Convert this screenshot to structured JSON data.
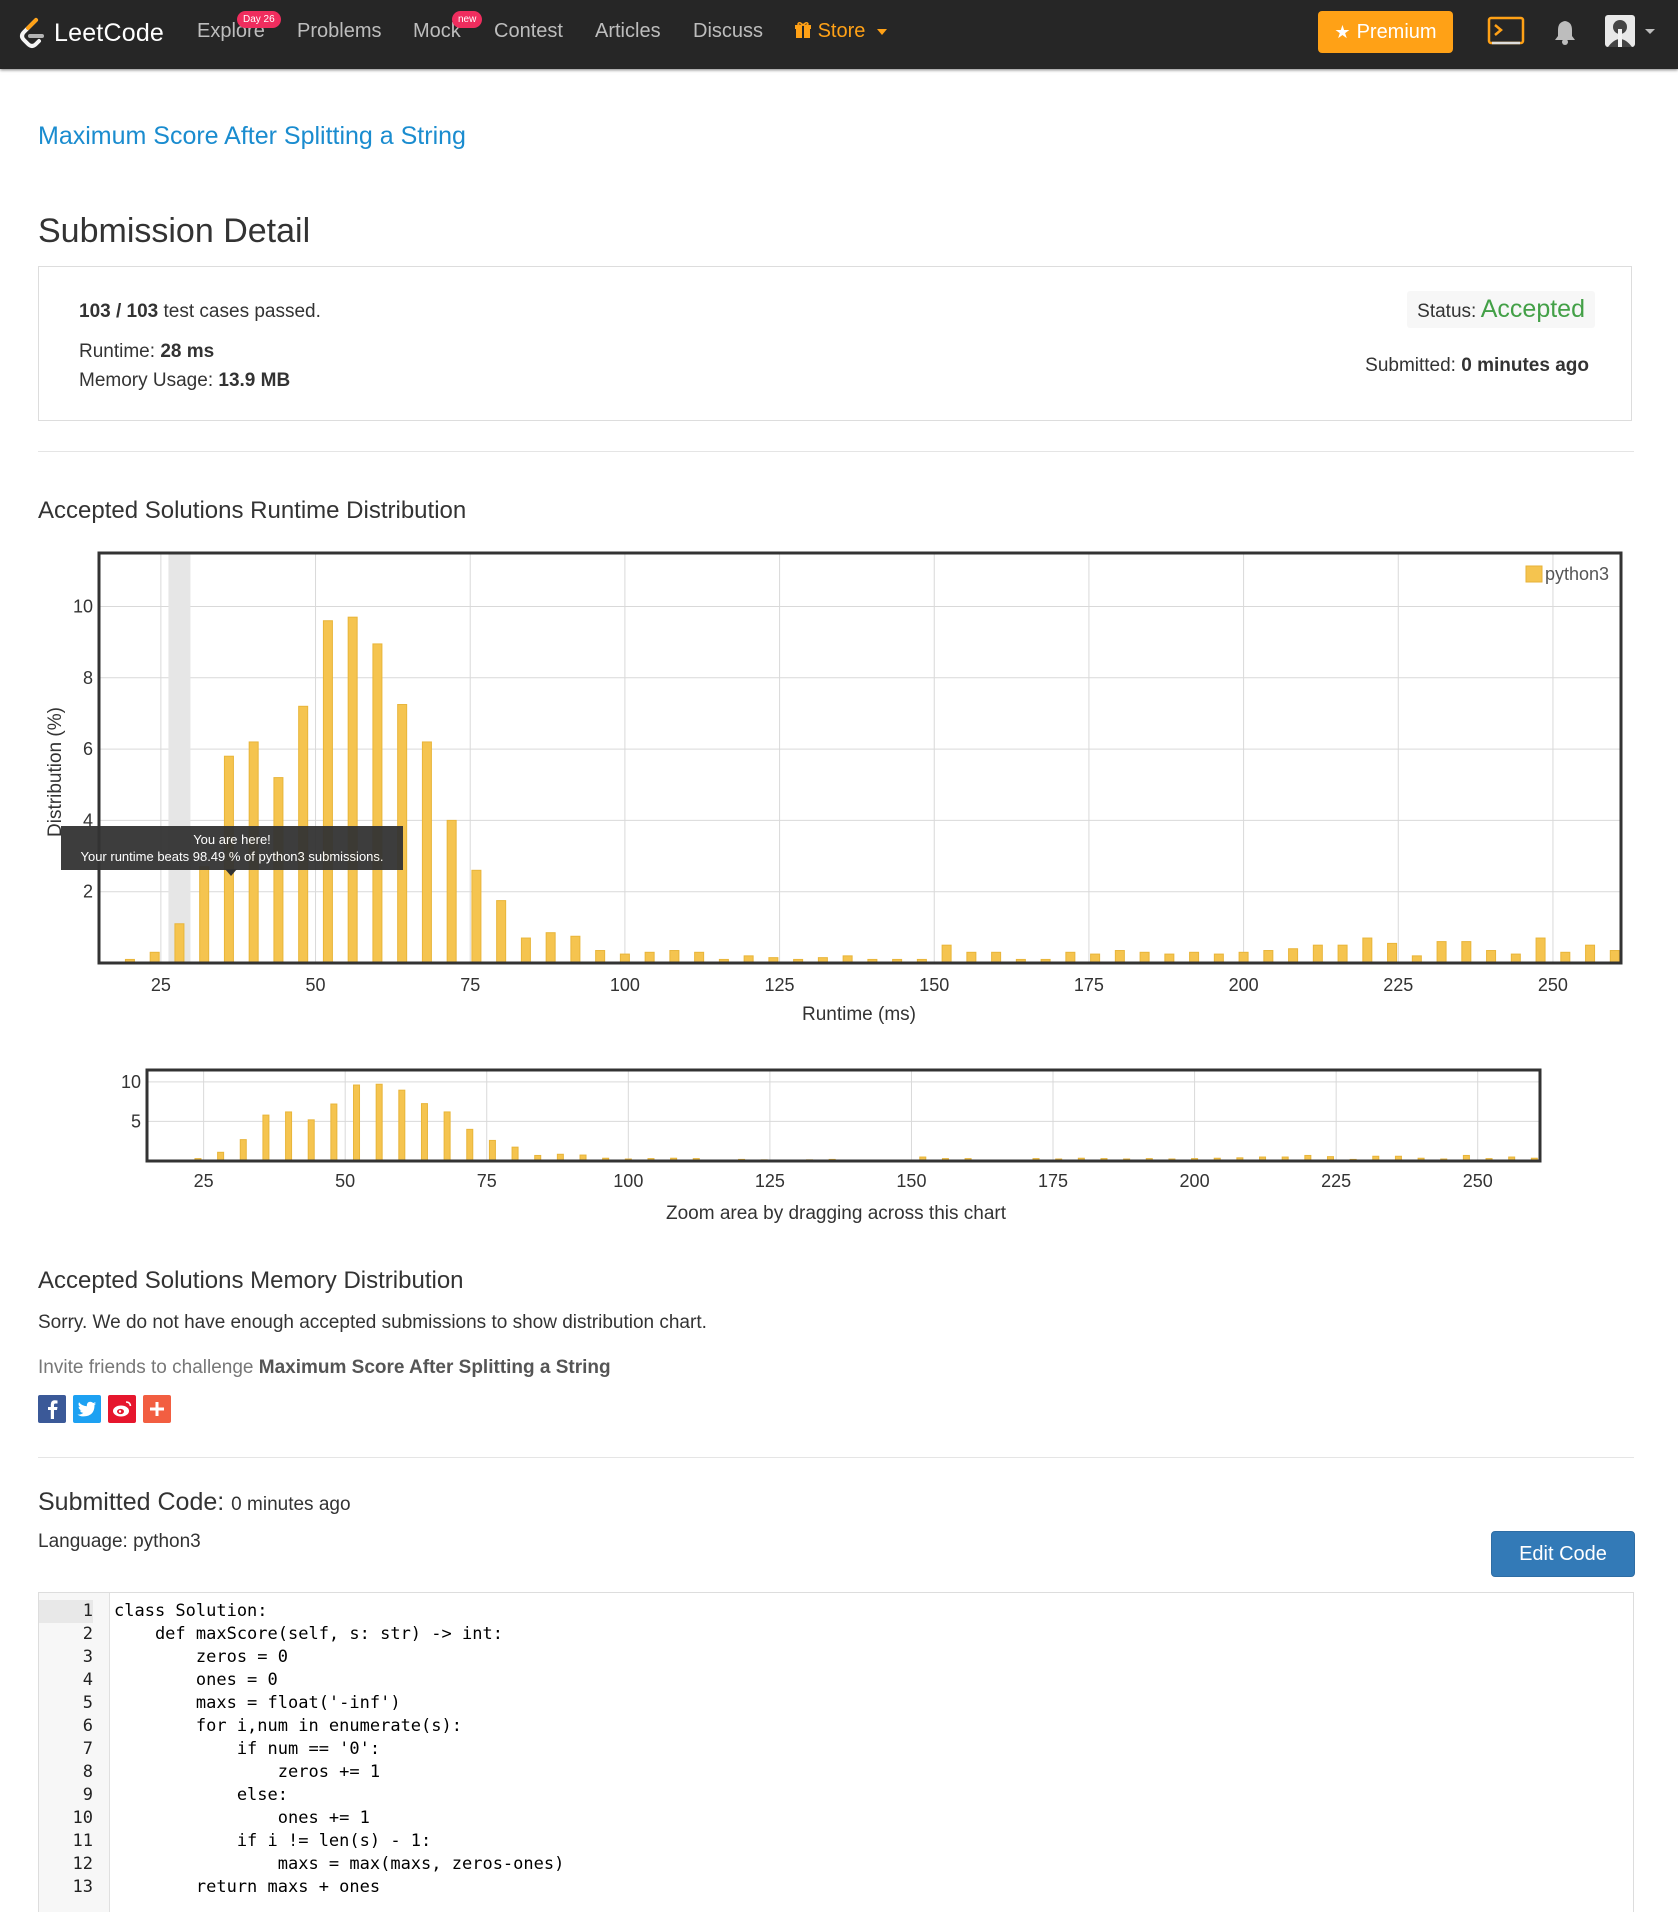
{
  "nav": {
    "logo_text": "LeetCode",
    "items": [
      {
        "label": "Explore",
        "badge": "Day 26"
      },
      {
        "label": "Problems"
      },
      {
        "label": "Mock",
        "badge": "new"
      },
      {
        "label": "Contest"
      },
      {
        "label": "Articles"
      },
      {
        "label": "Discuss"
      },
      {
        "label": "Store"
      }
    ],
    "premium_label": "Premium"
  },
  "problem": {
    "title": "Maximum Score After Splitting a String"
  },
  "submission": {
    "heading": "Submission Detail",
    "cases_passed": "103 / 103",
    "cases_suffix": "test cases passed.",
    "runtime_label": "Runtime:",
    "runtime_value": "28 ms",
    "memory_label": "Memory Usage:",
    "memory_value": "13.9 MB",
    "status_label": "Status:",
    "status_value": "Accepted",
    "submitted_label": "Submitted:",
    "submitted_value": "0 minutes ago"
  },
  "runtime_section": {
    "title": "Accepted Solutions Runtime Distribution",
    "tooltip_line1": "You are here!",
    "tooltip_line2": "Your runtime beats 98.49 % of python3 submissions.",
    "zoom_hint": "Zoom area by dragging across this chart"
  },
  "chart_data": {
    "type": "bar",
    "title": "",
    "xlabel": "Runtime (ms)",
    "ylabel": "Distribution (%)",
    "xlim": [
      15,
      261
    ],
    "ylim": [
      0,
      11.5
    ],
    "xticks": [
      25,
      50,
      75,
      100,
      125,
      150,
      175,
      200,
      225,
      250
    ],
    "yticks": [
      2,
      4,
      6,
      8,
      10
    ],
    "legend": {
      "label": "python3",
      "position": "top-right"
    },
    "grid": true,
    "highlight_x": 28,
    "color": "#f5c44f",
    "series": [
      {
        "name": "python3",
        "x": [
          20,
          24,
          28,
          32,
          36,
          40,
          44,
          48,
          52,
          56,
          60,
          64,
          68,
          72,
          76,
          80,
          84,
          88,
          92,
          96,
          100,
          104,
          108,
          112,
          116,
          120,
          124,
          128,
          132,
          136,
          140,
          144,
          148,
          152,
          156,
          160,
          164,
          168,
          172,
          176,
          180,
          184,
          188,
          192,
          196,
          200,
          204,
          208,
          212,
          216,
          220,
          224,
          228,
          232,
          236,
          240,
          244,
          248,
          252,
          256,
          260
        ],
        "values": [
          0.1,
          0.3,
          1.1,
          2.7,
          5.8,
          6.2,
          5.2,
          7.2,
          9.6,
          9.7,
          8.95,
          7.25,
          6.2,
          4.0,
          2.6,
          1.75,
          0.7,
          0.85,
          0.75,
          0.35,
          0.25,
          0.3,
          0.35,
          0.3,
          0.1,
          0.2,
          0.15,
          0.1,
          0.15,
          0.2,
          0.1,
          0.1,
          0.1,
          0.5,
          0.3,
          0.3,
          0.1,
          0.1,
          0.3,
          0.25,
          0.35,
          0.3,
          0.25,
          0.3,
          0.25,
          0.3,
          0.35,
          0.4,
          0.5,
          0.5,
          0.7,
          0.55,
          0.2,
          0.6,
          0.6,
          0.35,
          0.25,
          0.7,
          0.3,
          0.5,
          0.35
        ]
      }
    ],
    "zoom_chart": {
      "ylim": [
        0,
        11.5
      ],
      "yticks": [
        5,
        10
      ],
      "xticks": [
        25,
        50,
        75,
        100,
        125,
        150,
        175,
        200,
        225,
        250
      ]
    }
  },
  "memory_section": {
    "title": "Accepted Solutions Memory Distribution",
    "message": "Sorry. We do not have enough accepted submissions to show distribution chart.",
    "invite_prefix": "Invite friends to challenge",
    "invite_problem": "Maximum Score After Splitting a String"
  },
  "share_buttons": [
    {
      "name": "facebook",
      "color": "#3b5998",
      "glyph": "f"
    },
    {
      "name": "twitter",
      "color": "#1da1f2",
      "glyph": "t"
    },
    {
      "name": "weibo",
      "color": "#e6162d",
      "glyph": "w"
    },
    {
      "name": "more",
      "color": "#f25e41",
      "glyph": "+"
    }
  ],
  "code_section": {
    "title": "Submitted Code:",
    "time": "0 minutes ago",
    "language_label": "Language:",
    "language_value": "python3",
    "edit_button": "Edit Code",
    "lines": [
      "class Solution:",
      "    def maxScore(self, s: str) -> int:",
      "        zeros = 0",
      "        ones = 0",
      "        maxs = float('-inf')",
      "        for i,num in enumerate(s):",
      "            if num == '0':",
      "                zeros += 1",
      "            else:",
      "                ones += 1",
      "            if i != len(s) - 1:",
      "                maxs = max(maxs, zeros-ones)",
      "        return maxs + ones"
    ]
  },
  "colors": {
    "navbar": "#262626",
    "link": "#1a8ccf",
    "accepted": "#43a047",
    "premium": "#ffa116",
    "bar": "#f5c44f",
    "edit_button": "#337ab7"
  }
}
